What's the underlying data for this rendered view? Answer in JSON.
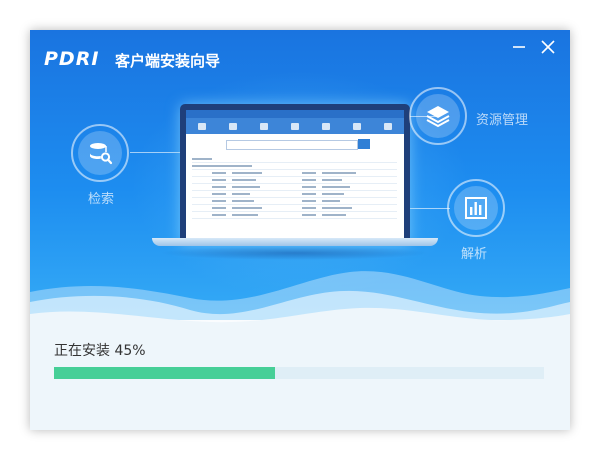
{
  "window": {
    "logo": "PDRI",
    "title": "客户端安装向导",
    "controls": {
      "minimize_icon": "minimize-icon",
      "close_icon": "close-icon"
    }
  },
  "features": [
    {
      "name": "search",
      "label": "检索",
      "icon": "database-search-icon"
    },
    {
      "name": "resource-management",
      "label": "资源管理",
      "icon": "layers-icon"
    },
    {
      "name": "analysis",
      "label": "解析",
      "icon": "bar-chart-icon"
    }
  ],
  "install": {
    "status_text": "正在安装 45%",
    "progress": 0.45
  },
  "colors": {
    "banner_top": "#1a74e0",
    "banner_bottom": "#35abf6",
    "progress_fill": "#46cf97",
    "progress_track": "#dfeef6",
    "background": "#eef6fb"
  }
}
